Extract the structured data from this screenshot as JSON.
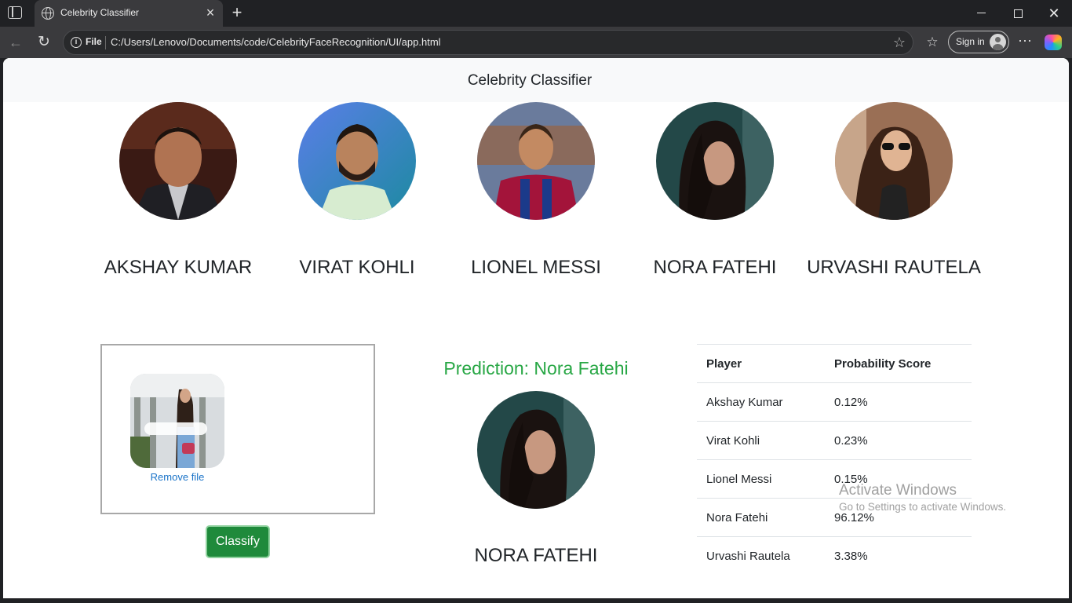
{
  "browser": {
    "tab_title": "Celebrity Classifier",
    "file_chip": "File",
    "url": "C:/Users/Lenovo/Documents/code/CelebrityFaceRecognition/UI/app.html",
    "signin_label": "Sign in"
  },
  "page": {
    "brand": "Celebrity Classifier",
    "celebrities": [
      {
        "name": "AKSHAY KUMAR"
      },
      {
        "name": "VIRAT KOHLI"
      },
      {
        "name": "LIONEL MESSI"
      },
      {
        "name": "NORA FATEHI"
      },
      {
        "name": "URVASHI RAUTELA"
      }
    ],
    "upload": {
      "remove_label": "Remove file",
      "classify_label": "Classify"
    },
    "prediction": {
      "label": "Prediction: Nora Fatehi",
      "name": "NORA FATEHI"
    },
    "table": {
      "headers": [
        "Player",
        "Probability Score"
      ],
      "rows": [
        [
          "Akshay Kumar",
          "0.12%"
        ],
        [
          "Virat Kohli",
          "0.23%"
        ],
        [
          "Lionel Messi",
          "0.15%"
        ],
        [
          "Nora Fatehi",
          "96.12%"
        ],
        [
          "Urvashi Rautela",
          "3.38%"
        ]
      ]
    }
  },
  "watermark": {
    "title": "Activate Windows",
    "subtitle": "Go to Settings to activate Windows."
  }
}
